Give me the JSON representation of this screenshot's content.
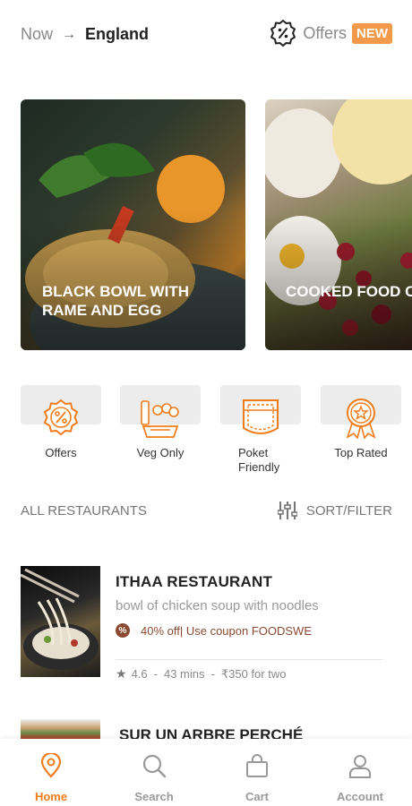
{
  "header": {
    "location_prefix": "Now",
    "location_city": "England",
    "offers_label": "Offers",
    "offers_badge": "NEW"
  },
  "banners": [
    {
      "title": "BLACK BOWL WITH RAME AND EGG"
    },
    {
      "title": "COOKED FOOD C KAHLO"
    }
  ],
  "categories": [
    {
      "label": "Offers",
      "icon": "discount-badge-icon"
    },
    {
      "label": "Veg Only",
      "icon": "vegetable-basket-icon"
    },
    {
      "label": "Poket Friendly",
      "icon": "pocket-icon"
    },
    {
      "label": "Top Rated",
      "icon": "award-star-icon"
    }
  ],
  "section": {
    "title": "ALL RESTAURANTS",
    "sort_label": "SORT/FILTER"
  },
  "restaurants": [
    {
      "name": "ITHAA RESTAURANT",
      "description": "bowl of chicken soup with noodles",
      "offer": "40% off| Use coupon FOODSWE",
      "rating": "4.6",
      "time": "43 mins",
      "price": "₹350 for two"
    },
    {
      "name": "SUR UN ARBRE PERCHÉ"
    }
  ],
  "nav": [
    {
      "label": "Home",
      "icon": "location-pin-icon",
      "active": true
    },
    {
      "label": "Search",
      "icon": "search-icon",
      "active": false
    },
    {
      "label": "Cart",
      "icon": "shopping-bag-icon",
      "active": false
    },
    {
      "label": "Account",
      "icon": "user-icon",
      "active": false
    }
  ],
  "colors": {
    "accent": "#f07c1b",
    "badge": "#f2994a",
    "offer_text": "#8a4a32"
  }
}
